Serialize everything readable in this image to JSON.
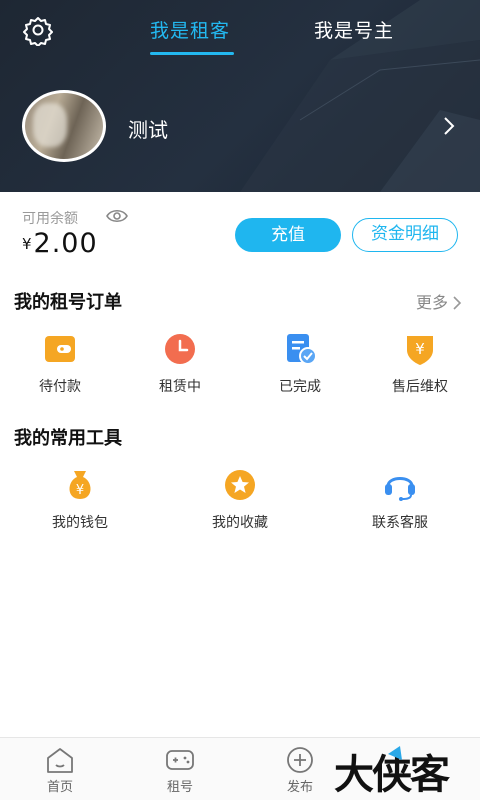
{
  "header": {
    "tabs": [
      {
        "label": "我是租客",
        "active": true
      },
      {
        "label": "我是号主",
        "active": false
      }
    ],
    "username": "测试"
  },
  "balance": {
    "label": "可用余额",
    "currency": "¥",
    "amount": "2.00",
    "charge_label": "充值",
    "detail_label": "资金明细"
  },
  "orders": {
    "title": "我的租号订单",
    "more_label": "更多",
    "items": [
      {
        "label": "待付款",
        "icon": "wallet-icon"
      },
      {
        "label": "租赁中",
        "icon": "clock-icon"
      },
      {
        "label": "已完成",
        "icon": "document-check-icon"
      },
      {
        "label": "售后维权",
        "icon": "yuan-shield-icon"
      }
    ]
  },
  "tools": {
    "title": "我的常用工具",
    "items": [
      {
        "label": "我的钱包",
        "icon": "money-bag-icon"
      },
      {
        "label": "我的收藏",
        "icon": "star-icon"
      },
      {
        "label": "联系客服",
        "icon": "headset-icon"
      }
    ]
  },
  "bottom_nav": {
    "items": [
      {
        "label": "首页",
        "icon": "home-icon"
      },
      {
        "label": "租号",
        "icon": "gamepad-icon"
      },
      {
        "label": "发布",
        "icon": "plus-circle-icon"
      }
    ]
  },
  "watermark": {
    "text": "大侠客"
  },
  "colors": {
    "accent": "#1fb6ef",
    "header_bg": "#1e2733",
    "orange": "#f5a623",
    "red_orange": "#f26d4f",
    "blue": "#3a8ff0"
  }
}
